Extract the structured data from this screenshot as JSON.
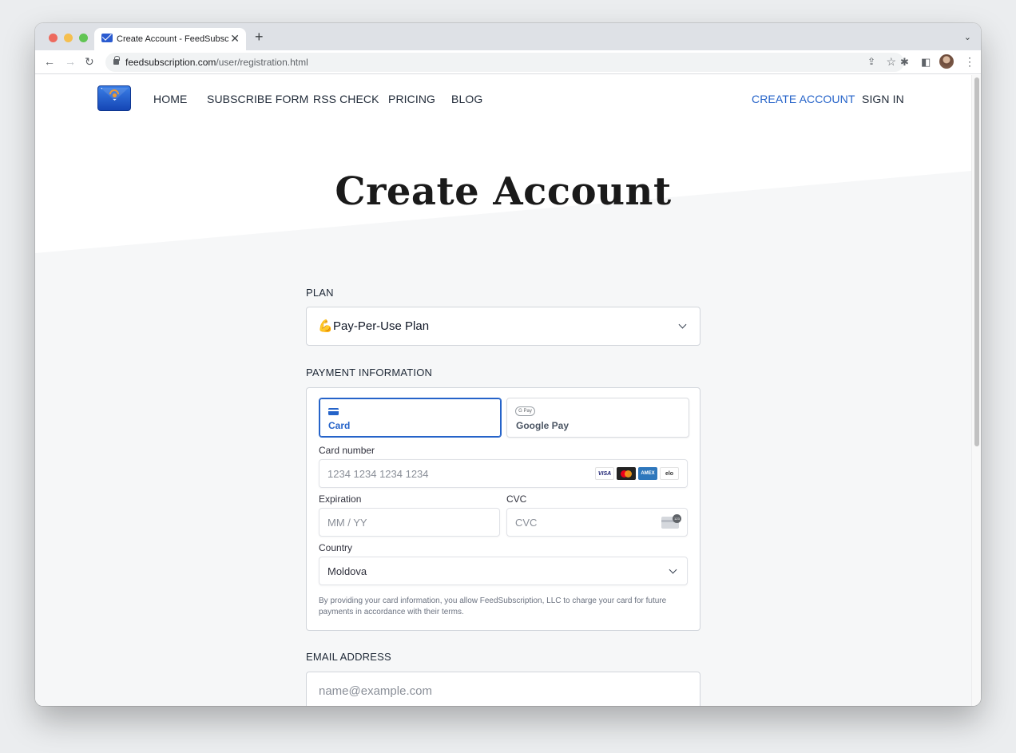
{
  "browser": {
    "tab_title": "Create Account - FeedSubscription",
    "tab_close": "✕",
    "new_tab": "+",
    "tab_menu": "⌄",
    "url_domain": "feedsubscription.com",
    "url_path": "/user/registration.html"
  },
  "nav": {
    "links": [
      "HOME",
      "SUBSCRIBE FORM",
      "RSS CHECK",
      "PRICING",
      "BLOG"
    ],
    "create_account": "CREATE ACCOUNT",
    "sign_in": "SIGN IN"
  },
  "page": {
    "title": "Create Account"
  },
  "plan": {
    "label": "PLAN",
    "emoji": "💪",
    "selected": "Pay-Per-Use Plan"
  },
  "payment": {
    "label": "PAYMENT INFORMATION",
    "tabs": [
      {
        "label": "Card",
        "icon": "card-icon"
      },
      {
        "label": "Google Pay",
        "icon": "google-pay-icon",
        "badge": "G Pay"
      }
    ],
    "card_number": {
      "label": "Card number",
      "placeholder": "1234 1234 1234 1234"
    },
    "card_brands": [
      "VISA",
      "",
      "AMEX",
      "elo"
    ],
    "expiration": {
      "label": "Expiration",
      "placeholder": "MM / YY"
    },
    "cvc": {
      "label": "CVC",
      "placeholder": "CVC"
    },
    "country": {
      "label": "Country",
      "value": "Moldova"
    },
    "terms": "By providing your card information, you allow FeedSubscription, LLC to charge your card for future payments in accordance with their terms."
  },
  "email": {
    "label": "EMAIL ADDRESS",
    "placeholder": "name@example.com"
  },
  "colors": {
    "accent": "#2563c9",
    "page_bg_lower": "#f6f7f8"
  }
}
